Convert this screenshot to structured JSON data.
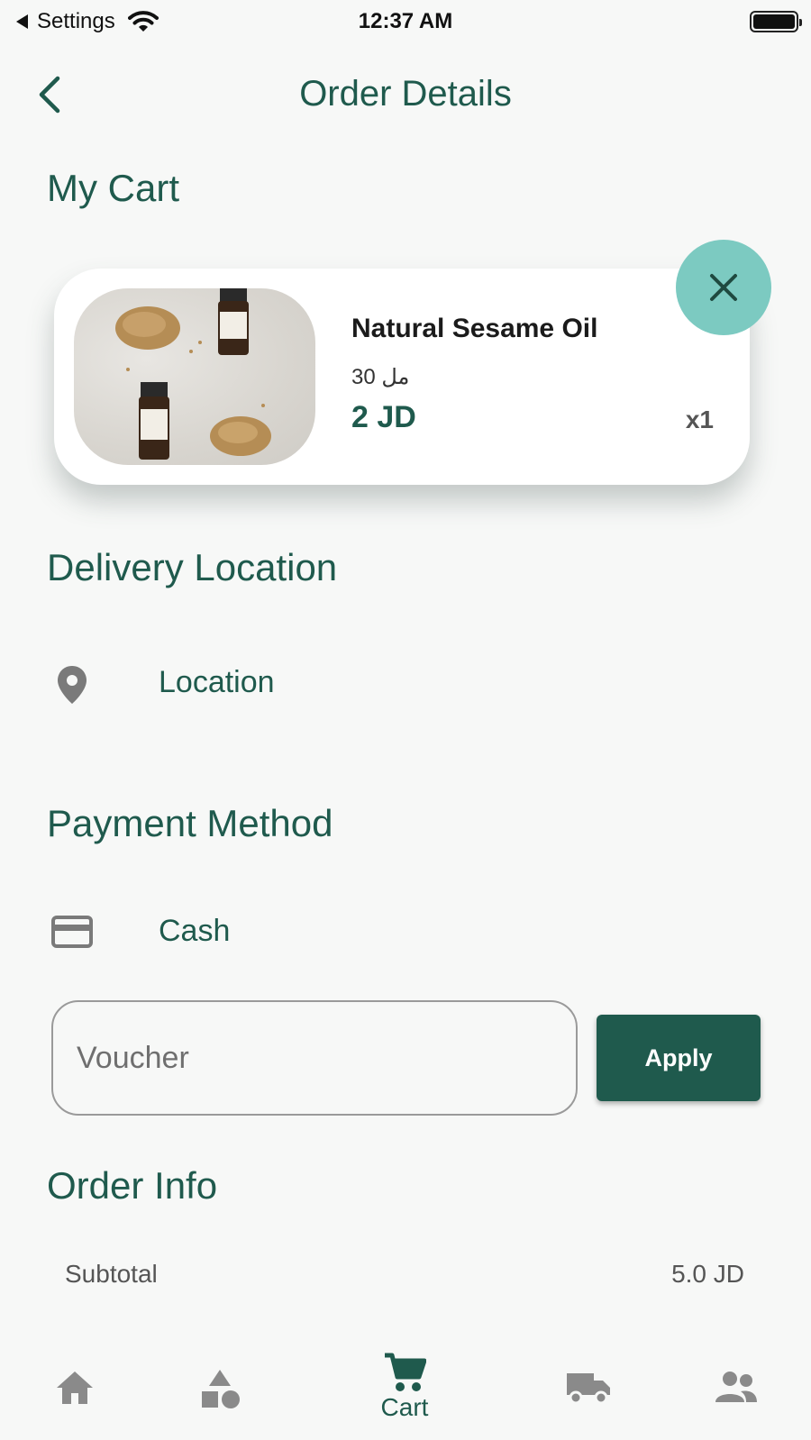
{
  "status_bar": {
    "back_app": "Settings",
    "time": "12:37 AM"
  },
  "header": {
    "title": "Order Details"
  },
  "cart": {
    "section_title": "My Cart",
    "items": [
      {
        "name": "Natural Sesame Oil",
        "size": "30 مل",
        "price": "2 JD",
        "quantity": "x1"
      }
    ]
  },
  "delivery": {
    "section_title": "Delivery Location",
    "location_label": "Location"
  },
  "payment": {
    "section_title": "Payment Method",
    "method_label": "Cash"
  },
  "voucher": {
    "placeholder": "Voucher",
    "apply_label": "Apply"
  },
  "order_info": {
    "section_title": "Order Info",
    "rows": [
      {
        "label": "Subtotal",
        "value": "5.0 JD"
      }
    ]
  },
  "bottom_nav": {
    "items": [
      {
        "icon": "home-icon",
        "label": ""
      },
      {
        "icon": "categories-icon",
        "label": ""
      },
      {
        "icon": "cart-icon",
        "label": "Cart",
        "active": true
      },
      {
        "icon": "truck-icon",
        "label": ""
      },
      {
        "icon": "people-icon",
        "label": ""
      }
    ]
  },
  "colors": {
    "primary": "#1f5a4d",
    "accent": "#7ccac1",
    "background": "#f7f8f7",
    "inactive_icon": "#8a8a8a"
  }
}
